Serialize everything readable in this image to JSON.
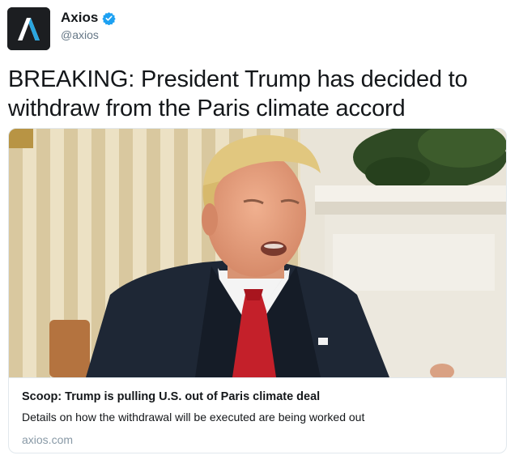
{
  "account": {
    "display_name": "Axios",
    "handle": "@axios",
    "avatar_icon": "axios-logo-icon",
    "verified_icon": "verified-badge-icon",
    "verified_color": "#1da1f2"
  },
  "tweet": {
    "text": "BREAKING: President Trump has decided to withdraw from the Paris climate accord"
  },
  "card": {
    "image_icon": "article-photo",
    "title": "Scoop: Trump is pulling U.S. out of Paris climate deal",
    "description": "Details on how the withdrawal will be executed are being worked out",
    "domain": "axios.com"
  }
}
